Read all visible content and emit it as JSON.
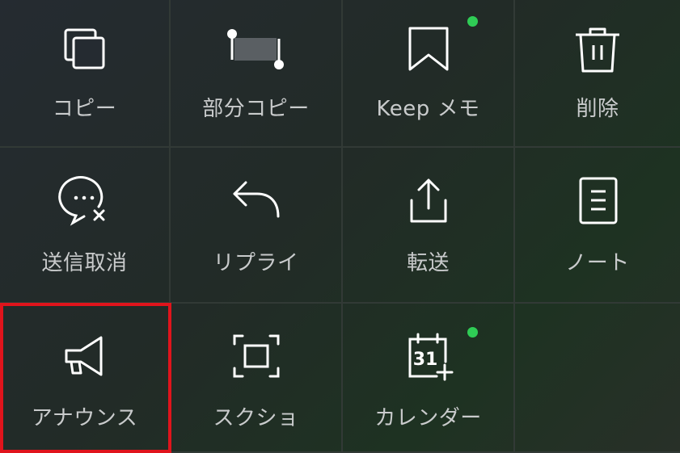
{
  "menu": {
    "items": [
      {
        "label": "コピー",
        "icon": "copy-icon"
      },
      {
        "label": "部分コピー",
        "icon": "partial-copy-icon"
      },
      {
        "label": "Keep メモ",
        "icon": "bookmark-icon",
        "new_badge": true
      },
      {
        "label": "削除",
        "icon": "trash-icon"
      },
      {
        "label": "送信取消",
        "icon": "unsend-icon"
      },
      {
        "label": "リプライ",
        "icon": "reply-icon"
      },
      {
        "label": "転送",
        "icon": "share-icon"
      },
      {
        "label": "ノート",
        "icon": "note-icon"
      },
      {
        "label": "アナウンス",
        "icon": "megaphone-icon",
        "highlighted": true
      },
      {
        "label": "スクショ",
        "icon": "screenshot-icon"
      },
      {
        "label": "カレンダー",
        "icon": "calendar-icon",
        "new_badge": true,
        "icon_text": "31"
      }
    ]
  },
  "colors": {
    "badge": "#2fcc55",
    "highlight_border": "#e0141c",
    "label": "#c9cbcc",
    "icon": "#ffffff"
  }
}
